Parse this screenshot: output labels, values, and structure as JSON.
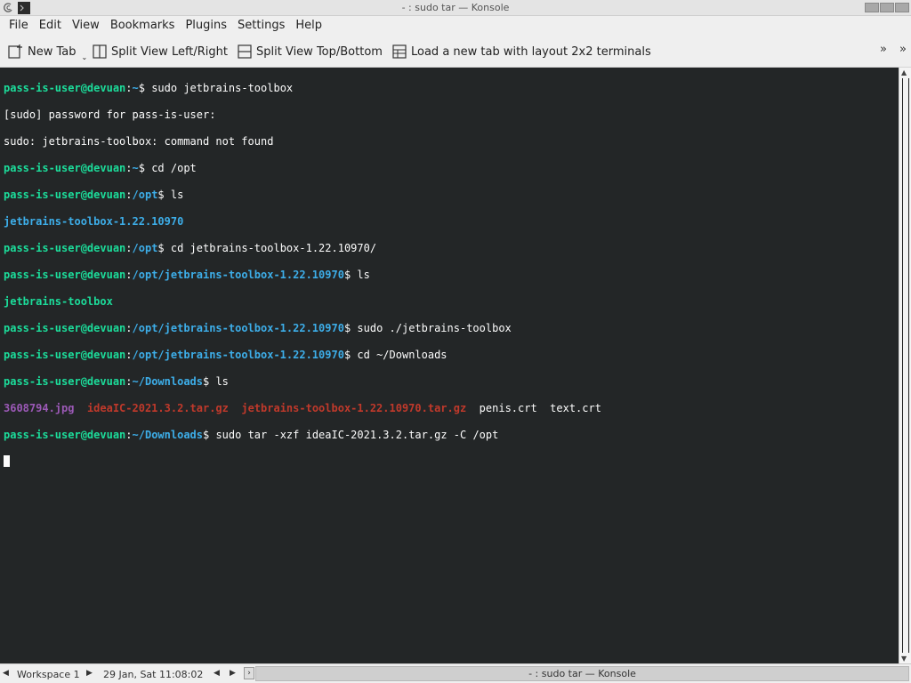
{
  "window": {
    "title": "- : sudo tar — Konsole",
    "app_icon": "debian-swirl-icon",
    "controls": [
      "minimize-icon",
      "maximize-icon",
      "close-icon"
    ]
  },
  "menubar": {
    "items": [
      "File",
      "Edit",
      "View",
      "Bookmarks",
      "Plugins",
      "Settings",
      "Help"
    ]
  },
  "toolbar": {
    "new_tab": "New Tab",
    "split_lr": "Split View Left/Right",
    "split_tb": "Split View Top/Bottom",
    "layout_2x2": "Load a new tab with layout 2x2 terminals",
    "more": "»"
  },
  "terminal": {
    "colors": {
      "background": "#232627",
      "user": "#1cdc9a",
      "path": "#3daee9",
      "image": "#9b59b6",
      "archive": "#c0392b",
      "text": "#fcfcfc"
    },
    "user": "pass-is-user@devuan",
    "lines": {
      "l1": {
        "path": "~",
        "cmd": "sudo jetbrains-toolbox"
      },
      "l2": {
        "text": "[sudo] password for pass-is-user:"
      },
      "l3": {
        "text": "sudo: jetbrains-toolbox: command not found"
      },
      "l4": {
        "path": "~",
        "cmd": "cd /opt"
      },
      "l5": {
        "path": "/opt",
        "cmd": "ls"
      },
      "l6": {
        "dir": "jetbrains-toolbox-1.22.10970"
      },
      "l7": {
        "path": "/opt",
        "cmd": "cd jetbrains-toolbox-1.22.10970/"
      },
      "l8": {
        "path": "/opt/jetbrains-toolbox-1.22.10970",
        "cmd": "ls"
      },
      "l9": {
        "exe": "jetbrains-toolbox"
      },
      "l10": {
        "path": "/opt/jetbrains-toolbox-1.22.10970",
        "cmd": "sudo ./jetbrains-toolbox"
      },
      "l11": {
        "path": "/opt/jetbrains-toolbox-1.22.10970",
        "cmd": "cd ~/Downloads"
      },
      "l12": {
        "path": "~/Downloads",
        "cmd": "ls"
      },
      "l13": {
        "f1": "3608794.jpg",
        "f2": "ideaIC-2021.3.2.tar.gz",
        "f3": "jetbrains-toolbox-1.22.10970.tar.gz",
        "f4": "penis.crt",
        "f5": "text.crt"
      },
      "l14": {
        "path": "~/Downloads",
        "cmd": "sudo tar -xzf ideaIC-2021.3.2.tar.gz -C /opt"
      }
    }
  },
  "taskbar": {
    "workspace": "Workspace 1",
    "clock": "29 Jan, Sat 11:08:02",
    "window_title": "- : sudo tar — Konsole"
  }
}
